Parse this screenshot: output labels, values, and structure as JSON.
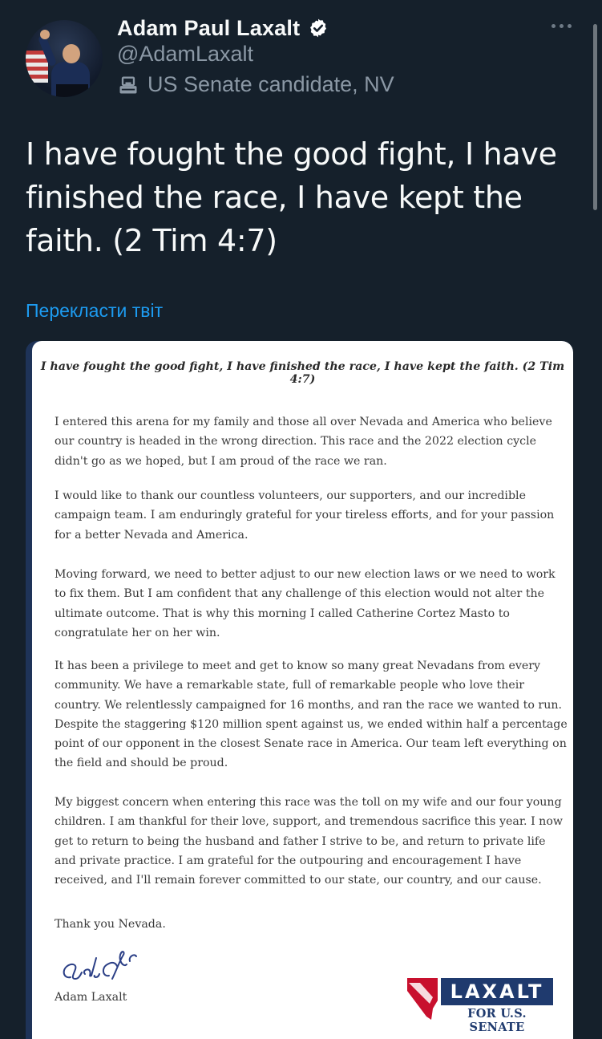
{
  "author": {
    "display_name": "Adam Paul Laxalt",
    "handle": "@AdamLaxalt",
    "label": "US Senate candidate, NV"
  },
  "tweet": {
    "text": "I have fought the good fight, I have finished the race, I have kept the faith. (2 Tim 4:7)",
    "translate_link": "Перекласти твіт"
  },
  "letter": {
    "heading": "I have fought the good fight, I have finished the race, I have kept the faith. (2 Tim 4:7)",
    "paragraphs": [
      "I entered this arena for my family and those all over Nevada and America who believe our country is headed in the wrong direction. This race and the 2022 election cycle didn't go as we hoped, but I am proud of the race we ran.",
      "I would like to thank our countless volunteers, our supporters, and our incredible campaign team. I am enduringly grateful for your tireless efforts, and for your passion for a better Nevada and America.",
      "Moving forward, we need to better adjust to our new election laws or we need to work to fix them. But I am confident that any challenge of this election would not alter the ultimate outcome. That is why this morning I called Catherine Cortez Masto to congratulate her on her win.",
      "It has been a privilege to meet and get to know so many great Nevadans from every community. We have a remarkable state, full of remarkable people who love their country. We relentlessly campaigned for 16 months, and ran the race we wanted to run. Despite the staggering $120 million spent against us, we ended within half a percentage point of our opponent in the closest Senate race in America. Our team left everything on the field and should be proud.",
      "My biggest concern when entering this race was the toll on my wife and our four young children. I am thankful for their love, support, and tremendous sacrifice this year. I now get to return to being the husband and father I strive to be, and return to private life and private practice. I am grateful for the outpouring and encouragement I have received, and I'll remain forever committed to our state, our country, and our cause."
    ],
    "closing": "Thank you Nevada.",
    "signer": "Adam Laxalt",
    "logo": {
      "word": "LAXALT",
      "sub": "FOR U.S. SENATE"
    }
  },
  "colors": {
    "background": "#15202b",
    "link": "#1d9bf0",
    "muted": "#8b98a5",
    "verified": "#ffffff",
    "logo_navy": "#1f3a6e",
    "logo_red": "#c8102e"
  },
  "icons": {
    "verified": "verified-badge-icon",
    "label": "government-building-icon",
    "more": "more-icon"
  }
}
